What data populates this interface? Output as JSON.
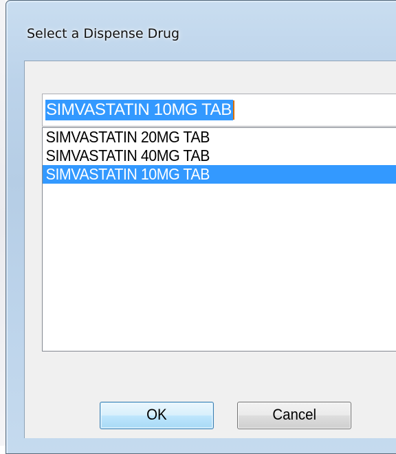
{
  "dialog": {
    "title": "Select a Dispense Drug",
    "search_value": "SIMVASTATIN 10MG TAB",
    "items": [
      {
        "label": "SIMVASTATIN 20MG TAB",
        "selected": false
      },
      {
        "label": "SIMVASTATIN 40MG TAB",
        "selected": false
      },
      {
        "label": "SIMVASTATIN 10MG TAB",
        "selected": true
      }
    ],
    "ok_label": "OK",
    "cancel_label": "Cancel"
  },
  "colors": {
    "selection": "#3399ff",
    "frame": "#b9d1ea",
    "client_bg": "#f0f0f0"
  }
}
